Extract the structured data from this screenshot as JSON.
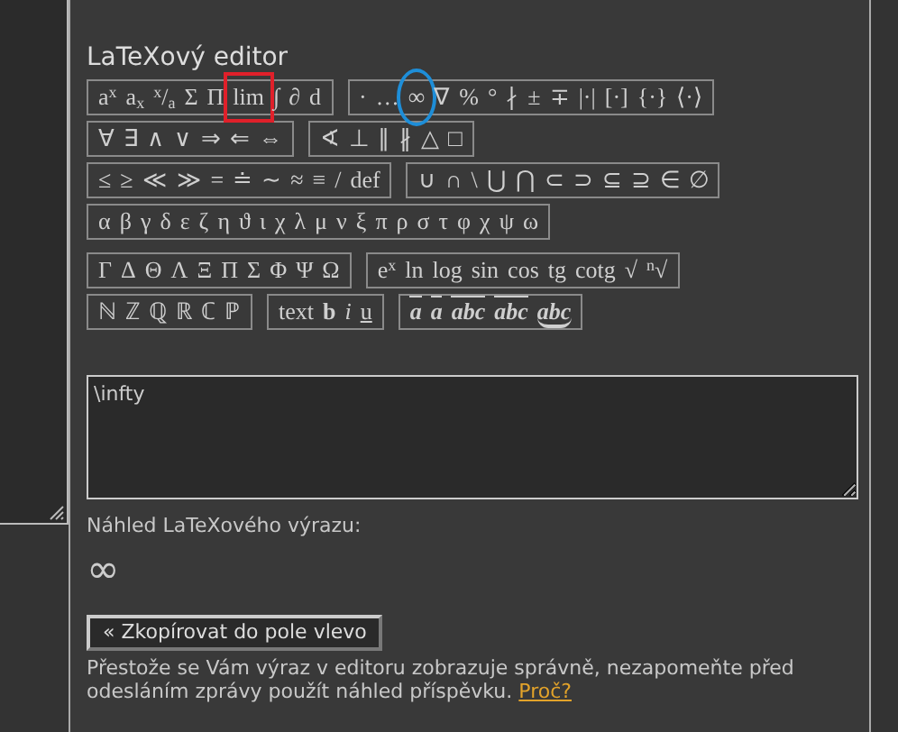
{
  "editor": {
    "title": "LaTeXový editor",
    "toolbar_rows": [
      [
        {
          "symbols": [
            {
              "text": "a$^{x}$",
              "kind": "plain"
            },
            {
              "text": "a$_{x}$",
              "kind": "plain"
            },
            {
              "text": "$^{x}$/$_{a}$",
              "kind": "plain"
            },
            {
              "text": "Σ",
              "kind": "plain"
            },
            {
              "text": "Π",
              "kind": "plain"
            },
            {
              "text": "lim",
              "kind": "plain",
              "boxed": true
            },
            {
              "text": "∫",
              "kind": "plain"
            },
            {
              "text": "∂",
              "kind": "plain"
            },
            {
              "text": "d",
              "kind": "plain"
            }
          ]
        },
        {
          "symbols": [
            {
              "text": "·",
              "kind": "plain"
            },
            {
              "text": "…",
              "kind": "plain"
            },
            {
              "text": "∞",
              "kind": "plain",
              "circled": true
            },
            {
              "text": "∇",
              "kind": "plain"
            },
            {
              "text": "%",
              "kind": "plain"
            },
            {
              "text": "°",
              "kind": "plain"
            },
            {
              "text": "∤",
              "kind": "plain"
            },
            {
              "text": "±",
              "kind": "plain"
            },
            {
              "text": "∓",
              "kind": "plain"
            },
            {
              "text": "|·|",
              "kind": "plain"
            },
            {
              "text": "[·]",
              "kind": "plain"
            },
            {
              "text": "{·}",
              "kind": "plain"
            },
            {
              "text": "⟨·⟩",
              "kind": "plain"
            }
          ]
        }
      ],
      [
        {
          "symbols": [
            {
              "text": "∀",
              "kind": "plain"
            },
            {
              "text": "∃",
              "kind": "plain"
            },
            {
              "text": "∧",
              "kind": "plain"
            },
            {
              "text": "∨",
              "kind": "plain"
            },
            {
              "text": "⇒",
              "kind": "plain"
            },
            {
              "text": "⇐",
              "kind": "plain"
            },
            {
              "text": "⇔",
              "kind": "plain"
            }
          ]
        },
        {
          "symbols": [
            {
              "text": "∢",
              "kind": "plain"
            },
            {
              "text": "⊥",
              "kind": "plain"
            },
            {
              "text": "∥",
              "kind": "plain"
            },
            {
              "text": "∦",
              "kind": "plain"
            },
            {
              "text": "△",
              "kind": "plain"
            },
            {
              "text": "□",
              "kind": "plain"
            }
          ]
        }
      ],
      [
        {
          "symbols": [
            {
              "text": "≤",
              "kind": "plain"
            },
            {
              "text": "≥",
              "kind": "plain"
            },
            {
              "text": "≪",
              "kind": "plain"
            },
            {
              "text": "≫",
              "kind": "plain"
            },
            {
              "text": "=",
              "kind": "plain"
            },
            {
              "text": "≐",
              "kind": "plain"
            },
            {
              "text": "∼",
              "kind": "plain"
            },
            {
              "text": "≈",
              "kind": "plain"
            },
            {
              "text": "≡",
              "kind": "plain"
            },
            {
              "text": "/",
              "kind": "plain"
            },
            {
              "text": "def",
              "kind": "plain"
            }
          ]
        },
        {
          "symbols": [
            {
              "text": "∪",
              "kind": "plain"
            },
            {
              "text": "∩",
              "kind": "plain"
            },
            {
              "text": "\\",
              "kind": "plain"
            },
            {
              "text": "⋃",
              "kind": "plain"
            },
            {
              "text": "⋂",
              "kind": "plain"
            },
            {
              "text": "⊂",
              "kind": "plain"
            },
            {
              "text": "⊃",
              "kind": "plain"
            },
            {
              "text": "⊆",
              "kind": "plain"
            },
            {
              "text": "⊇",
              "kind": "plain"
            },
            {
              "text": "∈",
              "kind": "plain"
            },
            {
              "text": "∅",
              "kind": "plain"
            }
          ]
        }
      ],
      [
        {
          "symbols": [
            {
              "text": "α",
              "kind": "plain"
            },
            {
              "text": "β",
              "kind": "plain"
            },
            {
              "text": "γ",
              "kind": "plain"
            },
            {
              "text": "δ",
              "kind": "plain"
            },
            {
              "text": "ε",
              "kind": "plain"
            },
            {
              "text": "ζ",
              "kind": "plain"
            },
            {
              "text": "η",
              "kind": "plain"
            },
            {
              "text": "ϑ",
              "kind": "plain"
            },
            {
              "text": "ι",
              "kind": "plain"
            },
            {
              "text": "χ",
              "kind": "plain"
            },
            {
              "text": "λ",
              "kind": "plain"
            },
            {
              "text": "μ",
              "kind": "plain"
            },
            {
              "text": "ν",
              "kind": "plain"
            },
            {
              "text": "ξ",
              "kind": "plain"
            },
            {
              "text": "π",
              "kind": "plain"
            },
            {
              "text": "ρ",
              "kind": "plain"
            },
            {
              "text": "σ",
              "kind": "plain"
            },
            {
              "text": "τ",
              "kind": "plain"
            },
            {
              "text": "φ",
              "kind": "plain"
            },
            {
              "text": "χ",
              "kind": "plain"
            },
            {
              "text": "ψ",
              "kind": "plain"
            },
            {
              "text": "ω",
              "kind": "plain"
            }
          ]
        }
      ],
      [
        {
          "symbols": [
            {
              "text": "Γ",
              "kind": "plain"
            },
            {
              "text": "Δ",
              "kind": "plain"
            },
            {
              "text": "Θ",
              "kind": "plain"
            },
            {
              "text": "Λ",
              "kind": "plain"
            },
            {
              "text": "Ξ",
              "kind": "plain"
            },
            {
              "text": "Π",
              "kind": "plain"
            },
            {
              "text": "Σ",
              "kind": "plain"
            },
            {
              "text": "Φ",
              "kind": "plain"
            },
            {
              "text": "Ψ",
              "kind": "plain"
            },
            {
              "text": "Ω",
              "kind": "plain"
            }
          ]
        },
        {
          "symbols": [
            {
              "text": "e$^{x}$",
              "kind": "plain"
            },
            {
              "text": "ln",
              "kind": "plain"
            },
            {
              "text": "log",
              "kind": "plain"
            },
            {
              "text": "sin",
              "kind": "plain"
            },
            {
              "text": "cos",
              "kind": "plain"
            },
            {
              "text": "tg",
              "kind": "plain"
            },
            {
              "text": "cotg",
              "kind": "plain"
            },
            {
              "text": "√",
              "kind": "plain"
            },
            {
              "text": "$^{n}$√",
              "kind": "plain"
            }
          ]
        }
      ],
      [
        {
          "symbols": [
            {
              "text": "ℕ",
              "kind": "plain"
            },
            {
              "text": "ℤ",
              "kind": "plain"
            },
            {
              "text": "ℚ",
              "kind": "plain"
            },
            {
              "text": "ℝ",
              "kind": "plain"
            },
            {
              "text": "ℂ",
              "kind": "plain"
            },
            {
              "text": "ℙ",
              "kind": "plain"
            }
          ]
        },
        {
          "symbols": [
            {
              "text": "text",
              "kind": "plain"
            },
            {
              "text": "b",
              "kind": "bold"
            },
            {
              "text": "i",
              "kind": "italic"
            },
            {
              "text": "u",
              "kind": "underline"
            }
          ]
        },
        {
          "symbols": [
            {
              "text": "a",
              "kind": "vector"
            },
            {
              "text": "a",
              "kind": "bar"
            },
            {
              "text": "abc",
              "kind": "overarrow"
            },
            {
              "text": "abc",
              "kind": "overline"
            },
            {
              "text": "abc",
              "kind": "underbrace"
            }
          ]
        }
      ]
    ],
    "input": {
      "value": "\\infty"
    },
    "preview_label": "Náhled LaTeXového výrazu:",
    "preview": "∞",
    "copy_button": "« Zkopírovat do pole vlevo",
    "note": "Přestože se Vám výraz v editoru zobrazuje správně, nezapomeňte před odesláním zprávy použít náhled příspěvku.",
    "note_link": "Proč?"
  }
}
